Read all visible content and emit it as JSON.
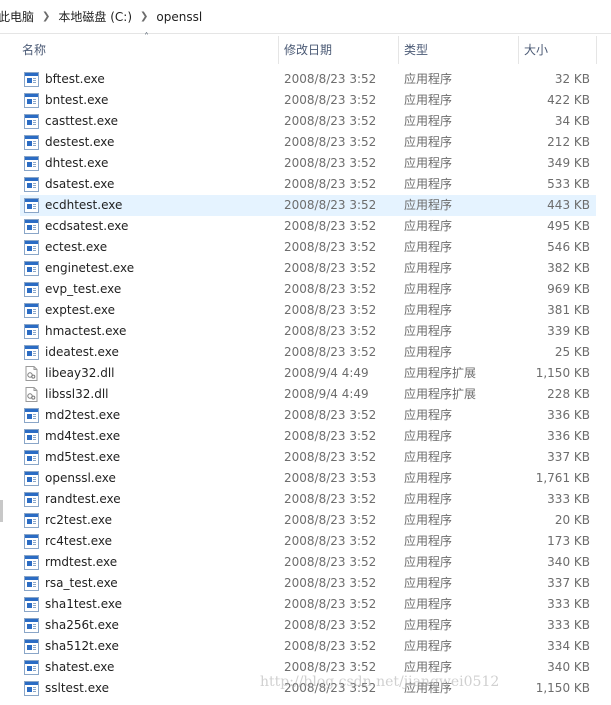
{
  "breadcrumb": [
    "此电脑",
    "本地磁盘 (C:)",
    "openssl"
  ],
  "columns": {
    "name": "名称",
    "date": "修改日期",
    "type": "类型",
    "size": "大小"
  },
  "files": [
    {
      "name": "bftest.exe",
      "date": "2008/8/23 3:52",
      "type": "应用程序",
      "size": "32 KB",
      "icon": "exe-icon"
    },
    {
      "name": "bntest.exe",
      "date": "2008/8/23 3:52",
      "type": "应用程序",
      "size": "422 KB",
      "icon": "exe-icon"
    },
    {
      "name": "casttest.exe",
      "date": "2008/8/23 3:52",
      "type": "应用程序",
      "size": "34 KB",
      "icon": "exe-icon"
    },
    {
      "name": "destest.exe",
      "date": "2008/8/23 3:52",
      "type": "应用程序",
      "size": "212 KB",
      "icon": "exe-icon"
    },
    {
      "name": "dhtest.exe",
      "date": "2008/8/23 3:52",
      "type": "应用程序",
      "size": "349 KB",
      "icon": "exe-icon"
    },
    {
      "name": "dsatest.exe",
      "date": "2008/8/23 3:52",
      "type": "应用程序",
      "size": "533 KB",
      "icon": "exe-icon"
    },
    {
      "name": "ecdhtest.exe",
      "date": "2008/8/23 3:52",
      "type": "应用程序",
      "size": "443 KB",
      "icon": "exe-icon",
      "selected": true
    },
    {
      "name": "ecdsatest.exe",
      "date": "2008/8/23 3:52",
      "type": "应用程序",
      "size": "495 KB",
      "icon": "exe-icon"
    },
    {
      "name": "ectest.exe",
      "date": "2008/8/23 3:52",
      "type": "应用程序",
      "size": "546 KB",
      "icon": "exe-icon"
    },
    {
      "name": "enginetest.exe",
      "date": "2008/8/23 3:52",
      "type": "应用程序",
      "size": "382 KB",
      "icon": "exe-icon"
    },
    {
      "name": "evp_test.exe",
      "date": "2008/8/23 3:52",
      "type": "应用程序",
      "size": "969 KB",
      "icon": "exe-icon"
    },
    {
      "name": "exptest.exe",
      "date": "2008/8/23 3:52",
      "type": "应用程序",
      "size": "381 KB",
      "icon": "exe-icon"
    },
    {
      "name": "hmactest.exe",
      "date": "2008/8/23 3:52",
      "type": "应用程序",
      "size": "339 KB",
      "icon": "exe-icon"
    },
    {
      "name": "ideatest.exe",
      "date": "2008/8/23 3:52",
      "type": "应用程序",
      "size": "25 KB",
      "icon": "exe-icon"
    },
    {
      "name": "libeay32.dll",
      "date": "2008/9/4 4:49",
      "type": "应用程序扩展",
      "size": "1,150 KB",
      "icon": "dll-icon"
    },
    {
      "name": "libssl32.dll",
      "date": "2008/9/4 4:49",
      "type": "应用程序扩展",
      "size": "228 KB",
      "icon": "dll-icon"
    },
    {
      "name": "md2test.exe",
      "date": "2008/8/23 3:52",
      "type": "应用程序",
      "size": "336 KB",
      "icon": "exe-icon"
    },
    {
      "name": "md4test.exe",
      "date": "2008/8/23 3:52",
      "type": "应用程序",
      "size": "336 KB",
      "icon": "exe-icon"
    },
    {
      "name": "md5test.exe",
      "date": "2008/8/23 3:52",
      "type": "应用程序",
      "size": "337 KB",
      "icon": "exe-icon"
    },
    {
      "name": "openssl.exe",
      "date": "2008/8/23 3:53",
      "type": "应用程序",
      "size": "1,761 KB",
      "icon": "exe-icon"
    },
    {
      "name": "randtest.exe",
      "date": "2008/8/23 3:52",
      "type": "应用程序",
      "size": "333 KB",
      "icon": "exe-icon"
    },
    {
      "name": "rc2test.exe",
      "date": "2008/8/23 3:52",
      "type": "应用程序",
      "size": "20 KB",
      "icon": "exe-icon"
    },
    {
      "name": "rc4test.exe",
      "date": "2008/8/23 3:52",
      "type": "应用程序",
      "size": "173 KB",
      "icon": "exe-icon"
    },
    {
      "name": "rmdtest.exe",
      "date": "2008/8/23 3:52",
      "type": "应用程序",
      "size": "340 KB",
      "icon": "exe-icon"
    },
    {
      "name": "rsa_test.exe",
      "date": "2008/8/23 3:52",
      "type": "应用程序",
      "size": "337 KB",
      "icon": "exe-icon"
    },
    {
      "name": "sha1test.exe",
      "date": "2008/8/23 3:52",
      "type": "应用程序",
      "size": "333 KB",
      "icon": "exe-icon"
    },
    {
      "name": "sha256t.exe",
      "date": "2008/8/23 3:52",
      "type": "应用程序",
      "size": "333 KB",
      "icon": "exe-icon"
    },
    {
      "name": "sha512t.exe",
      "date": "2008/8/23 3:52",
      "type": "应用程序",
      "size": "334 KB",
      "icon": "exe-icon"
    },
    {
      "name": "shatest.exe",
      "date": "2008/8/23 3:52",
      "type": "应用程序",
      "size": "340 KB",
      "icon": "exe-icon"
    },
    {
      "name": "ssltest.exe",
      "date": "2008/8/23 3:52",
      "type": "应用程序",
      "size": "1,150 KB",
      "icon": "exe-icon"
    }
  ],
  "watermark": "http://blog.csdn.net/jiangwei0512",
  "colors": {
    "selection": "#e5f3ff",
    "header_text": "#4b5a75",
    "exe_icon_blue": "#2b6cc4"
  }
}
